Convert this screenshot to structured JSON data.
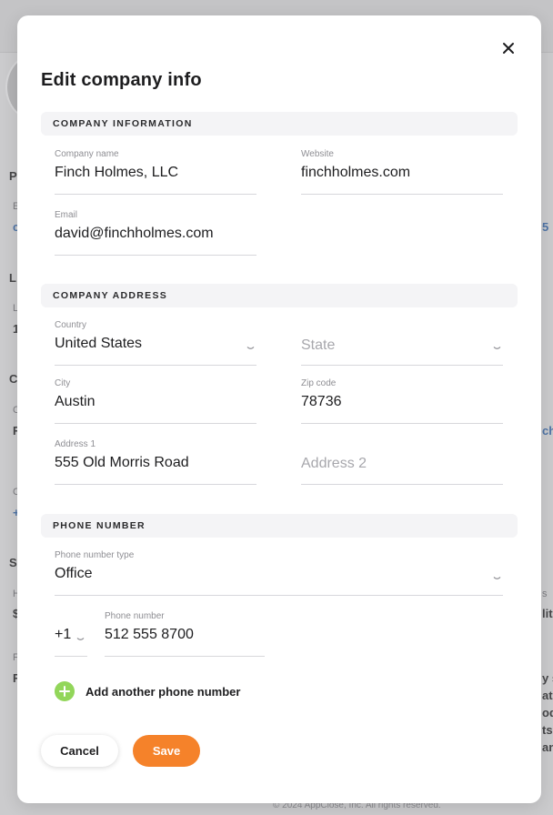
{
  "background": {
    "fragments": [
      "P",
      "E",
      "c",
      "L",
      "L",
      "1",
      "C",
      "C",
      "F",
      "C",
      "+",
      "S",
      "H",
      "$",
      "F",
      "F",
      "5",
      "ch",
      "s",
      "lit",
      "y s",
      "ate",
      "ody",
      "ts,",
      "anc"
    ],
    "footer": "© 2024 AppClose, Inc. All rights reserved."
  },
  "modal": {
    "title": "Edit company info",
    "close_icon": "close-icon",
    "sections": {
      "company_information": "COMPANY INFORMATION",
      "company_address": "COMPANY ADDRESS",
      "phone_number": "PHONE NUMBER"
    },
    "company": {
      "name_label": "Company name",
      "name_value": "Finch Holmes, LLC",
      "website_label": "Website",
      "website_value": "finchholmes.com",
      "email_label": "Email",
      "email_value": "david@finchholmes.com"
    },
    "address": {
      "country_label": "Country",
      "country_value": "United States",
      "state_placeholder": "State",
      "city_label": "City",
      "city_value": "Austin",
      "zip_label": "Zip code",
      "zip_value": "78736",
      "address1_label": "Address 1",
      "address1_value": "555 Old Morris Road",
      "address2_placeholder": "Address 2"
    },
    "phone": {
      "type_label": "Phone number type",
      "type_value": "Office",
      "country_code": "+1",
      "number_label": "Phone number",
      "number_value": "512 555 8700",
      "add_another": "Add another phone number"
    },
    "buttons": {
      "cancel": "Cancel",
      "save": "Save"
    },
    "colors": {
      "accent": "#f5822a",
      "add_icon": "#92d65a"
    }
  }
}
